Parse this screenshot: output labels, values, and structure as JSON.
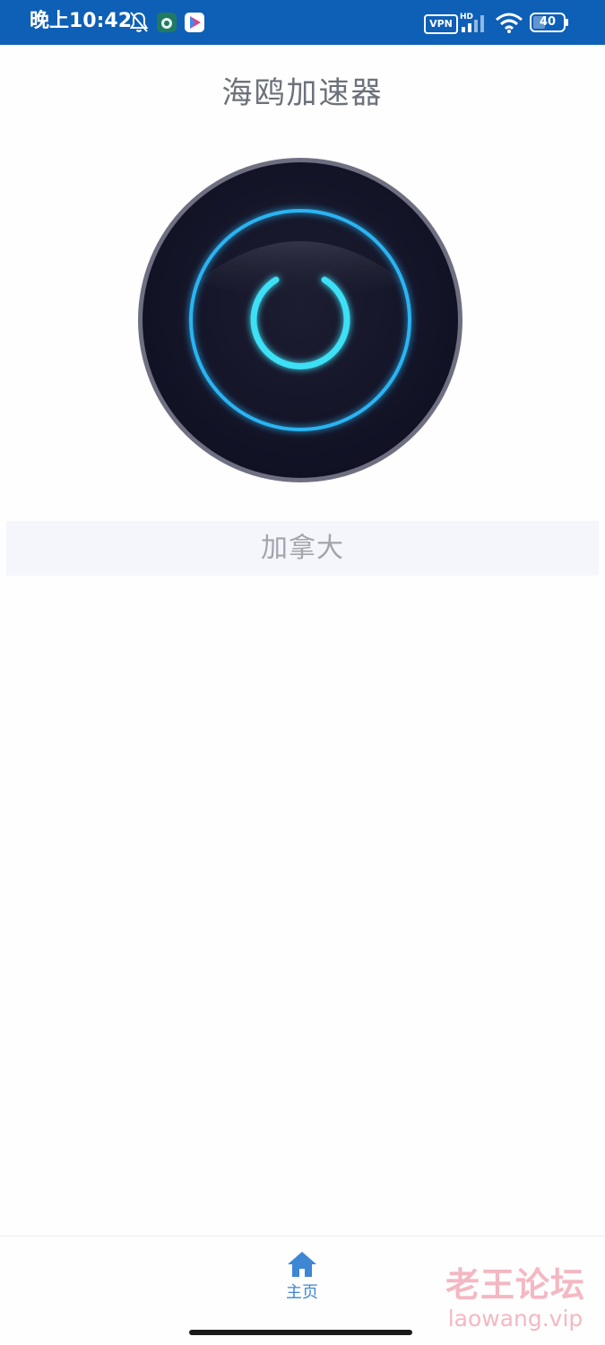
{
  "status_bar": {
    "time": "晚上10:42",
    "vpn": "VPN",
    "signal_label": "HD",
    "battery": "40",
    "icons": [
      "bell-off-icon",
      "cloud-app-icon",
      "play-app-icon",
      "signal-icon",
      "wifi-icon",
      "battery-icon"
    ]
  },
  "app": {
    "title": "海鸥加速器"
  },
  "power_button": {
    "icon": "power-icon",
    "ring_color": "#2ab4f3",
    "glyph_color": "#3ee0f5"
  },
  "region": {
    "label": "加拿大"
  },
  "bottom_nav": {
    "items": [
      {
        "label": "主页",
        "icon": "home-icon",
        "active": true
      }
    ],
    "accent": "#3d87d4"
  },
  "watermark": {
    "line1": "老王论坛",
    "line2": "laowang.vip"
  }
}
